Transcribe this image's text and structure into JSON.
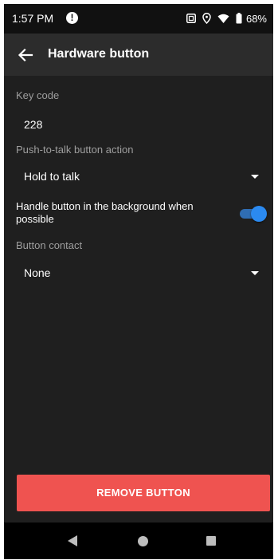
{
  "status_bar": {
    "time": "1:57 PM",
    "alert_icon": "!",
    "battery_percent": "68%",
    "icons": [
      "alert-icon",
      "screenshot-icon",
      "location-icon",
      "wifi-icon",
      "battery-icon"
    ]
  },
  "app_bar": {
    "title": "Hardware button",
    "back_icon": "arrow-left-icon"
  },
  "settings": {
    "key_code_label": "Key code",
    "key_code_value": "228",
    "ptt_action_label": "Push-to-talk button action",
    "ptt_action_value": "Hold to talk",
    "background_toggle_label": "Handle button in the background when possible",
    "background_toggle_on": true,
    "button_contact_label": "Button contact",
    "button_contact_value": "None"
  },
  "actions": {
    "remove_button_label": "REMOVE BUTTON"
  },
  "colors": {
    "background": "#1f1f1f",
    "app_bar": "#2c2c2c",
    "status_bar": "#111111",
    "accent_toggle": "#2b8af0",
    "remove_button": "#ef5350",
    "label_gray": "#9e9e9e"
  },
  "nav_bar": {
    "icons": [
      "nav-back-icon",
      "nav-home-icon",
      "nav-recents-icon"
    ]
  }
}
